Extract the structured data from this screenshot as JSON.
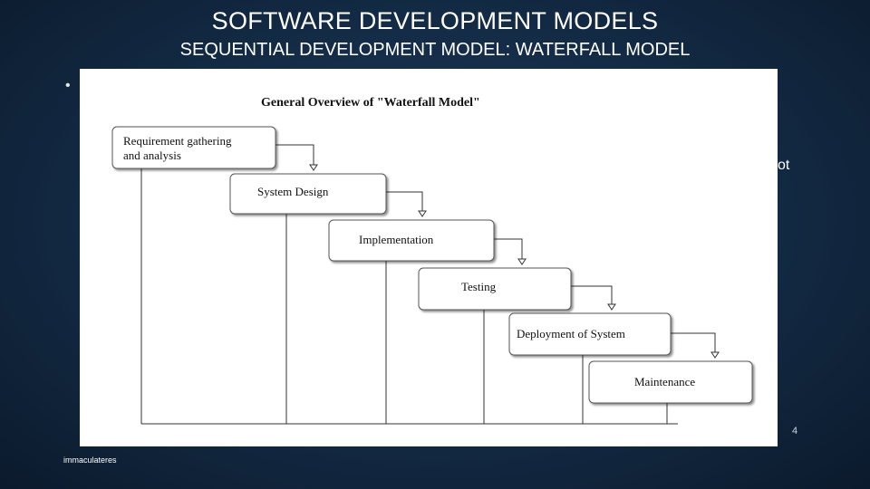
{
  "slide": {
    "title": "SOFTWARE DEVELOPMENT MODELS",
    "subtitle": "SEQUENTIAL DEVELOPMENT MODEL: WATERFALL MODEL",
    "bullet_symbol": "•",
    "obscured_text_fragment": "ot",
    "page_number": "4",
    "footer": "immaculateres"
  },
  "diagram": {
    "title": "General Overview of \"Waterfall Model\"",
    "stages": [
      {
        "line1": "Requirement gathering",
        "line2": "and analysis"
      },
      {
        "line1": "System Design",
        "line2": ""
      },
      {
        "line1": "Implementation",
        "line2": ""
      },
      {
        "line1": "Testing",
        "line2": ""
      },
      {
        "line1": "Deployment of System",
        "line2": ""
      },
      {
        "line1": "Maintenance",
        "line2": ""
      }
    ]
  },
  "colors": {
    "background": "#132a44",
    "diagram_background": "#ffffff",
    "diagram_ink": "#111111"
  }
}
